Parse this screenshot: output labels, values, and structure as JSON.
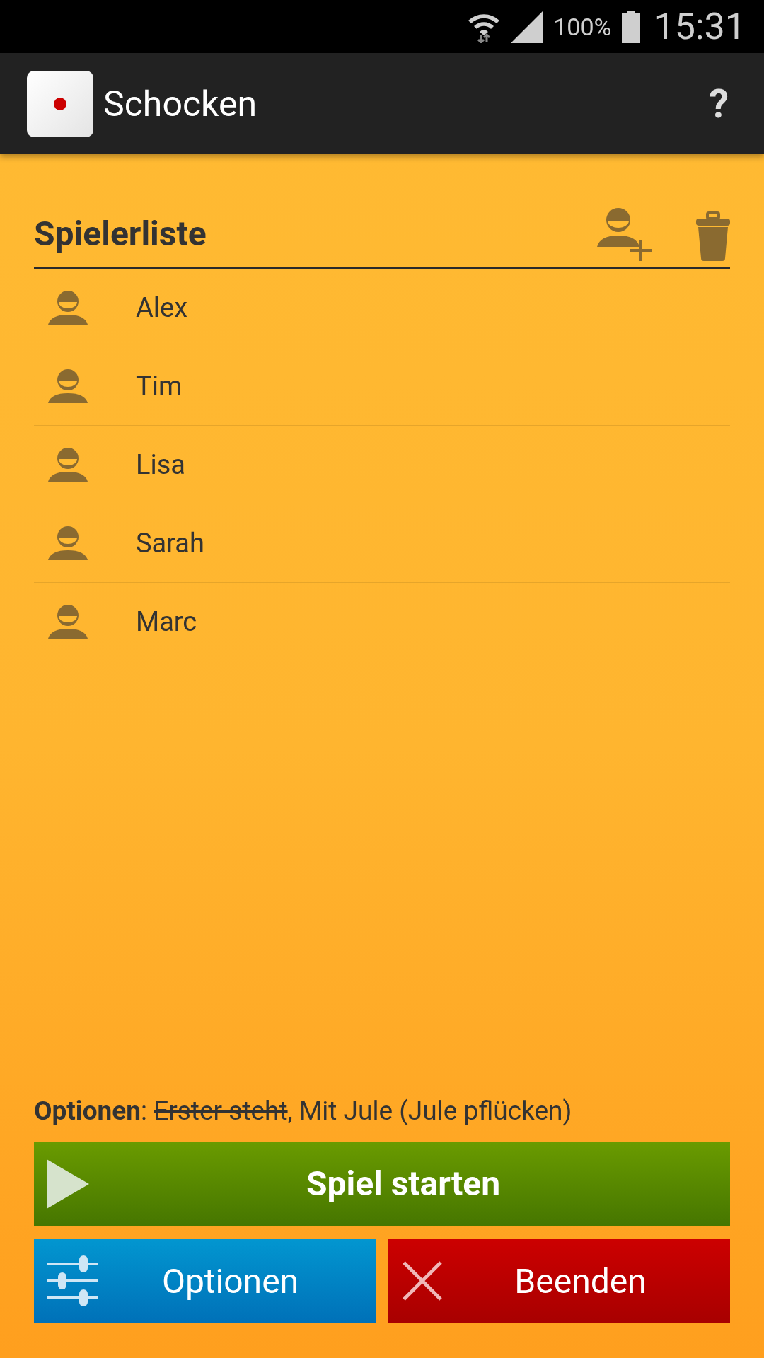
{
  "status_bar": {
    "battery": "100%",
    "time": "15:31"
  },
  "app_bar": {
    "title": "Schocken",
    "help": "?"
  },
  "player_list": {
    "title": "Spielerliste",
    "players": [
      {
        "name": "Alex"
      },
      {
        "name": "Tim"
      },
      {
        "name": "Lisa"
      },
      {
        "name": "Sarah"
      },
      {
        "name": "Marc"
      }
    ]
  },
  "options_summary": [
    {
      "kind": "label",
      "text": "Optionen"
    },
    {
      "kind": "plain",
      "text": ": "
    },
    {
      "kind": "option",
      "text": "Erster steht",
      "enabled": false
    },
    {
      "kind": "plain",
      "text": ", "
    },
    {
      "kind": "option",
      "text": "Mit Jule (Jule pflücken)",
      "enabled": true
    }
  ],
  "buttons": {
    "start": "Spiel starten",
    "options": "Optionen",
    "quit": "Beenden"
  }
}
